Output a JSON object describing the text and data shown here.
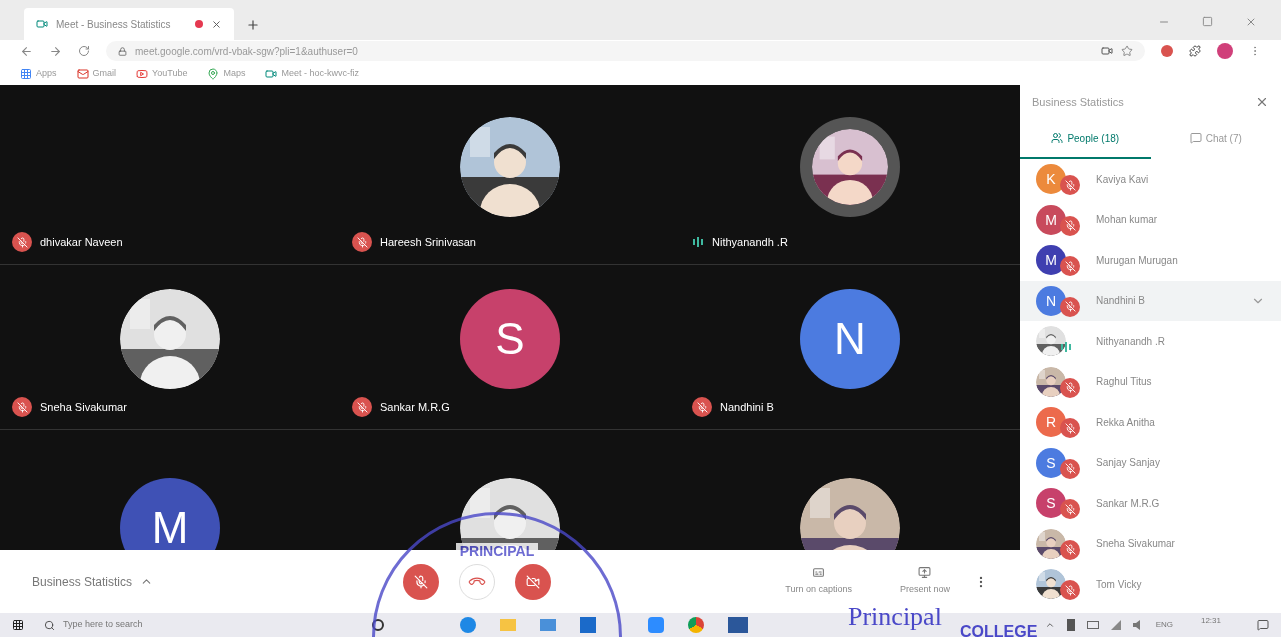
{
  "browser": {
    "tab_title": "Meet - Business Statistics",
    "url": "meet.google.com/vrd-vbak-sgw?pli=1&authuser=0",
    "bookmarks": [
      "Apps",
      "Gmail",
      "YouTube",
      "Maps",
      "Meet - hoc-kwvc-fiz"
    ]
  },
  "tiles": [
    {
      "name": "dhivakar Naveen",
      "muted": true
    },
    {
      "name": "Hareesh Srinivasan",
      "muted": true,
      "kind": "picture",
      "speaking": false
    },
    {
      "name": "Nithyanandh .R",
      "muted": false,
      "kind": "picture",
      "speaking": true
    },
    {
      "name": "Sneha Sivakumar",
      "muted": true,
      "kind": "picture",
      "speaking": false
    },
    {
      "name": "Sankar M.R.G",
      "muted": true,
      "kind": "letter",
      "letter": "S",
      "color": "#c7416b"
    },
    {
      "name": "Nandhini B",
      "muted": true,
      "kind": "letter",
      "letter": "N",
      "color": "#4c7be0"
    },
    {
      "kind": "letter",
      "letter": "M",
      "color": "#3f51b5"
    },
    {
      "kind": "picture",
      "speaking": false
    },
    {
      "kind": "picture",
      "speaking": false
    }
  ],
  "meeting_bar": {
    "title": "Business Statistics",
    "actions": [
      "Turn on captions",
      "Present now"
    ]
  },
  "panel": {
    "title": "Business Statistics",
    "tabs": [
      {
        "label": "People (18)",
        "selected": true
      },
      {
        "label": "Chat (7)",
        "selected": false
      }
    ],
    "people": [
      {
        "name": "Kaviya Kavi",
        "kind": "letter",
        "letter": "K",
        "color": "#ec8a3c",
        "muted": true,
        "selected": false
      },
      {
        "name": "Mohan kumar",
        "kind": "letter",
        "letter": "M",
        "color": "#c84a5c",
        "muted": true,
        "selected": false
      },
      {
        "name": "Murugan Murugan",
        "kind": "letter",
        "letter": "M",
        "color": "#3f3fb0",
        "muted": true,
        "selected": false
      },
      {
        "name": "Nandhini B",
        "kind": "letter",
        "letter": "N",
        "color": "#4c7be0",
        "muted": true,
        "selected": true
      },
      {
        "name": "Nithyanandh .R",
        "kind": "picture",
        "muted": false,
        "selected": false
      },
      {
        "name": "Raghul Titus",
        "kind": "picture",
        "muted": true,
        "selected": false
      },
      {
        "name": "Rekka Anitha",
        "kind": "letter",
        "letter": "R",
        "color": "#ec6a4c",
        "muted": true,
        "selected": false
      },
      {
        "name": "Sanjay Sanjay",
        "kind": "letter",
        "letter": "S",
        "color": "#4c7be0",
        "muted": true,
        "selected": false
      },
      {
        "name": "Sankar M.R.G",
        "kind": "letter",
        "letter": "S",
        "color": "#c7416b",
        "muted": true,
        "selected": false
      },
      {
        "name": "Sneha Sivakumar",
        "kind": "picture",
        "muted": true,
        "selected": false
      },
      {
        "name": "Tom Vicky",
        "kind": "picture",
        "muted": true,
        "selected": false
      }
    ]
  },
  "taskbar": {
    "search_placeholder": "Type here to search",
    "language": "ENG",
    "time": "12:31"
  },
  "stamp": {
    "seal_text": "PRINCIPAL",
    "signature": "Principal",
    "college": "COLLEGE"
  }
}
